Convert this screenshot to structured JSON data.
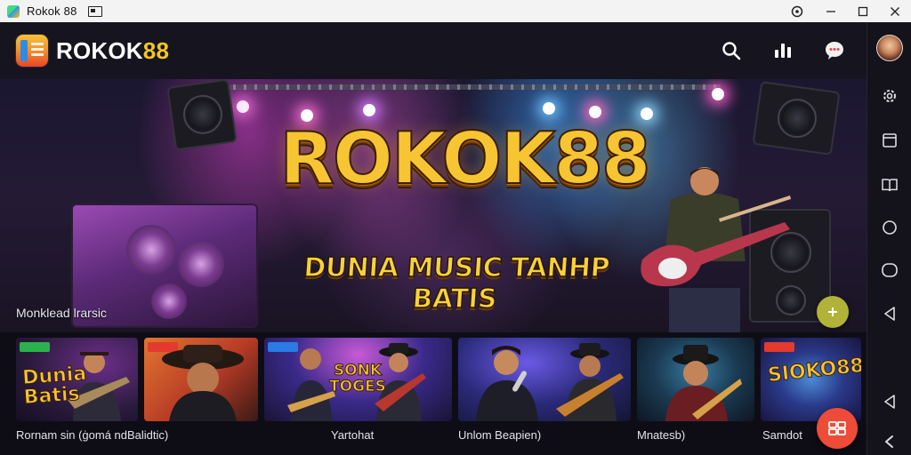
{
  "window": {
    "title": "Rokok 88",
    "controls": [
      "target-icon",
      "minimize-icon",
      "maximize-icon",
      "close-icon"
    ]
  },
  "header": {
    "brand_white": "ROKOK",
    "brand_gold": "88",
    "icons": [
      "search-icon",
      "chart-icon",
      "chat-icon"
    ]
  },
  "hero": {
    "title": "ROKOK88",
    "subtitle": "DUNIA MUSIC TANHP BATIS",
    "caption": "Monklead lrarsic",
    "fab_icon": "plus-icon"
  },
  "cards": [
    {
      "badge": "",
      "badge_color": "#2bb24c",
      "art_text": "Dunia Batis",
      "caption": "Rornam sin (ġomá ndBalidtic)"
    },
    {
      "badge": "",
      "badge_color": "#e23b2e",
      "art_text": "",
      "caption": ""
    },
    {
      "badge": "",
      "badge_color": "#2a7be4",
      "art_text": "SONK TOGES",
      "caption": "Yartohat"
    },
    {
      "badge": "",
      "badge_color": "",
      "art_text": "",
      "caption": "Unlom Beapien)"
    },
    {
      "badge": "",
      "badge_color": "",
      "art_text": "",
      "caption": "Mnatesb)"
    },
    {
      "badge": "",
      "badge_color": "#e23b2e",
      "art_text": "SIOKO88",
      "caption": "Samdot"
    }
  ],
  "fab": {
    "icon": "grid-icon",
    "color": "#ef4b39"
  },
  "rail": {
    "icons": [
      "avatar",
      "gear-icon",
      "window-icon",
      "book-icon",
      "circle-icon",
      "rounded-square-icon",
      "back-icon",
      "back-icon",
      "chevron-left-icon"
    ]
  },
  "colors": {
    "brand_gold": "#f3c51f",
    "background": "#0c0b14",
    "header": "#15141f",
    "accent_red": "#ef4b39"
  }
}
